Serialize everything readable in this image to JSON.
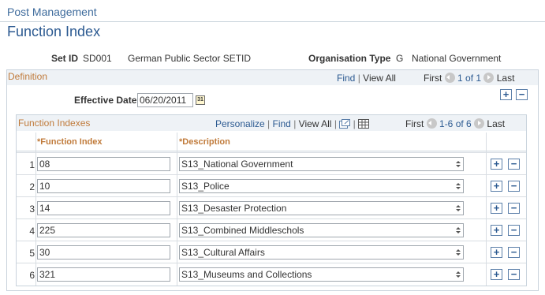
{
  "breadcrumb": "Post Management",
  "page_title": "Function Index",
  "set_id": {
    "label": "Set ID",
    "code": "SD001",
    "description": "German Public Sector SETID"
  },
  "org_type": {
    "label": "Organisation Type",
    "code": "G",
    "description": "National Government"
  },
  "definition": {
    "title": "Definition",
    "find": "Find",
    "view_all": "View All",
    "first": "First",
    "range": "1 of 1",
    "last": "Last",
    "effective_date_label": "Effective Date",
    "effective_date_value": "06/20/2011"
  },
  "grid": {
    "title": "Function Indexes",
    "personalize": "Personalize",
    "find": "Find",
    "view_all": "View All",
    "first": "First",
    "range": "1-6 of 6",
    "last": "Last",
    "col_function_index": "*Function Index",
    "col_description": "*Description",
    "rows": [
      {
        "num": "1",
        "index": "08",
        "description": "S13_National Government"
      },
      {
        "num": "2",
        "index": "10",
        "description": "S13_Police"
      },
      {
        "num": "3",
        "index": "14",
        "description": "S13_Desaster Protection"
      },
      {
        "num": "4",
        "index": "225",
        "description": "S13_Combined Middleschols"
      },
      {
        "num": "5",
        "index": "30",
        "description": "S13_Cultural Affairs"
      },
      {
        "num": "6",
        "index": "321",
        "description": "S13_Museums and Collections"
      }
    ]
  },
  "icons": {
    "add": "+",
    "delete": "−",
    "calendar": "31"
  }
}
